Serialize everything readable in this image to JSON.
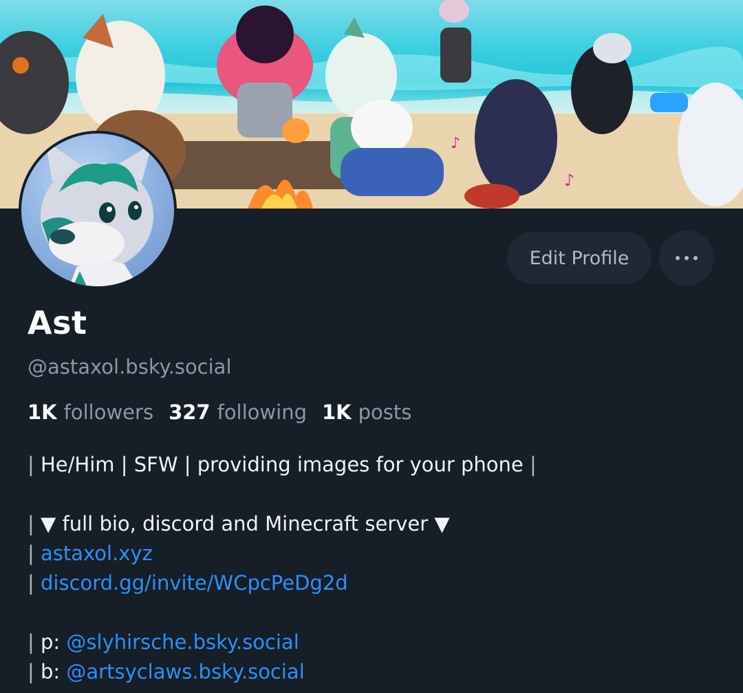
{
  "profile": {
    "display_name": "Ast",
    "handle": "@astaxol.bsky.social",
    "edit_button": "Edit Profile",
    "more_button": "•••"
  },
  "stats": [
    {
      "value": "1K",
      "label": "followers"
    },
    {
      "value": "327",
      "label": "following"
    },
    {
      "value": "1K",
      "label": "posts"
    }
  ],
  "bio": {
    "line1_bar_open": "|",
    "line1_text": " He/Him | SFW | providing images for your phone ",
    "line1_bar_close": "|",
    "line2_bar": "|",
    "line2_text": " ▼ full bio, discord and Minecraft server ▼",
    "line3_bar": "|",
    "line3_link": "astaxol.xyz",
    "line4_bar": "|",
    "line4_link": "discord.gg/invite/WCpcPeDg2d",
    "line5_bar": "|",
    "line5_prefix": " p: ",
    "line5_link": "@slyhirsche.bsky.social",
    "line6_bar": "|",
    "line6_prefix": " b: ",
    "line6_link": "@artsyclaws.bsky.social"
  },
  "colors": {
    "background": "#161e27",
    "button_bg": "#1e2935",
    "link": "#2f8ff6",
    "muted": "#8a98a8"
  }
}
